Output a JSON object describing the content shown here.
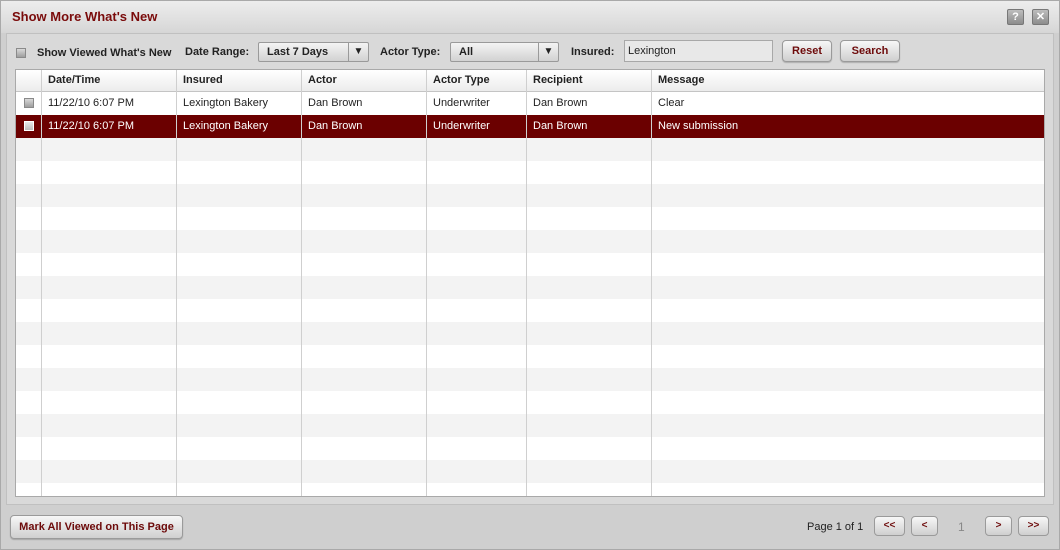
{
  "dialog": {
    "title": "Show More What's New",
    "help_icon_glyph": "?",
    "close_icon_glyph": "✕"
  },
  "filters": {
    "show_viewed_label": "Show Viewed What's New",
    "date_range_label": "Date Range:",
    "date_range_value": "Last 7 Days",
    "actor_type_label": "Actor Type:",
    "actor_type_value": "All",
    "insured_label": "Insured:",
    "insured_value": "Lexington",
    "dropdown_arrow": "▼",
    "reset_label": "Reset",
    "search_label": "Search"
  },
  "table": {
    "columns": [
      "Date/Time",
      "Insured",
      "Actor",
      "Actor Type",
      "Recipient",
      "Message"
    ],
    "rows": [
      {
        "datetime": "11/22/10  6:07 PM",
        "insured": "Lexington Bakery",
        "actor": "Dan Brown",
        "actor_type": "Underwriter",
        "recipient": "Dan Brown",
        "message": "Clear",
        "selected": false
      },
      {
        "datetime": "11/22/10  6:07 PM",
        "insured": "Lexington Bakery",
        "actor": "Dan Brown",
        "actor_type": "Underwriter",
        "recipient": "Dan Brown",
        "message": "New submission",
        "selected": true
      }
    ]
  },
  "footer": {
    "mark_all_label": "Mark All Viewed on This Page",
    "page_info": "Page 1 of 1",
    "first_label": "<<",
    "prev_label": "<",
    "current_page": "1",
    "next_label": ">",
    "last_label": ">>"
  },
  "colors": {
    "accent": "#7a0b0b",
    "selected_row": "#6b0000"
  }
}
